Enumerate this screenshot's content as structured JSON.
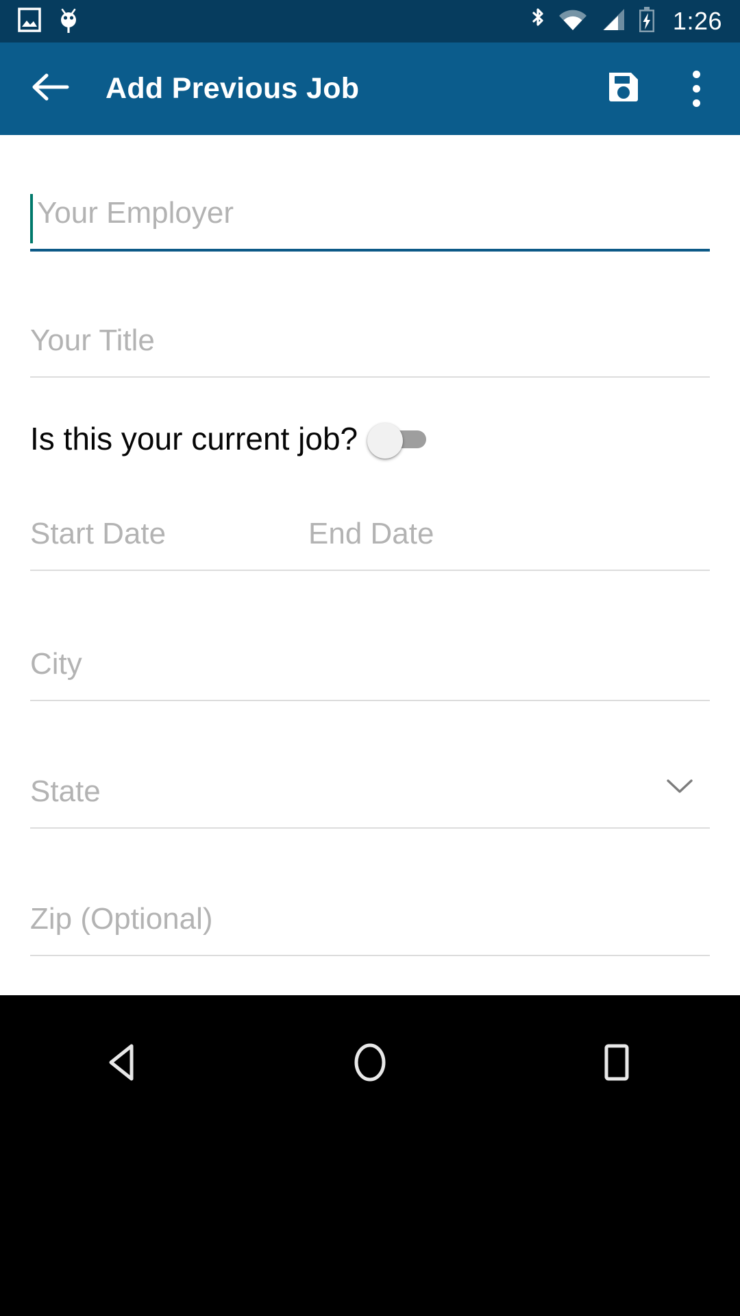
{
  "status_bar": {
    "background": "#063C5E",
    "clock": "1:26",
    "left_icons": [
      {
        "name": "screenshot-image-icon"
      },
      {
        "name": "android-debug-bug-icon"
      }
    ],
    "right_icons": [
      {
        "name": "bluetooth-icon"
      },
      {
        "name": "wifi-icon"
      },
      {
        "name": "cellular-signal-icon"
      },
      {
        "name": "battery-charging-icon"
      }
    ]
  },
  "app_bar": {
    "background": "#0B5C8C",
    "title": "Add Previous Job",
    "back_icon": "arrow-back-icon",
    "save_icon": "save-floppy-disk-icon",
    "overflow_icon": "more-vertical-icon"
  },
  "form": {
    "accent_focus_color": "#0D5A87",
    "caret_color": "#00796B",
    "fields": [
      {
        "id": "employer",
        "placeholder": "Your Employer",
        "value": "",
        "focused": true
      },
      {
        "id": "title",
        "placeholder": "Your Title",
        "value": "",
        "focused": false
      },
      {
        "id": "start_date",
        "placeholder": "Start Date",
        "value": "",
        "focused": false
      },
      {
        "id": "end_date",
        "placeholder": "End Date",
        "value": "",
        "focused": false
      },
      {
        "id": "city",
        "placeholder": "City",
        "value": "",
        "focused": false
      },
      {
        "id": "state",
        "placeholder": "State",
        "value": "",
        "focused": false
      },
      {
        "id": "zip",
        "placeholder": "Zip (Optional)",
        "value": "",
        "focused": false
      }
    ],
    "current_job_toggle": {
      "label": "Is this your current job?",
      "checked": false,
      "state_text": "off"
    },
    "state_dropdown_icon": "chevron-down-icon"
  },
  "nav_bar": {
    "background": "#000000",
    "buttons": [
      {
        "name": "nav-back-button",
        "icon": "triangle-back-icon"
      },
      {
        "name": "nav-home-button",
        "icon": "circle-home-icon"
      },
      {
        "name": "nav-recents-button",
        "icon": "square-recents-icon"
      }
    ]
  }
}
